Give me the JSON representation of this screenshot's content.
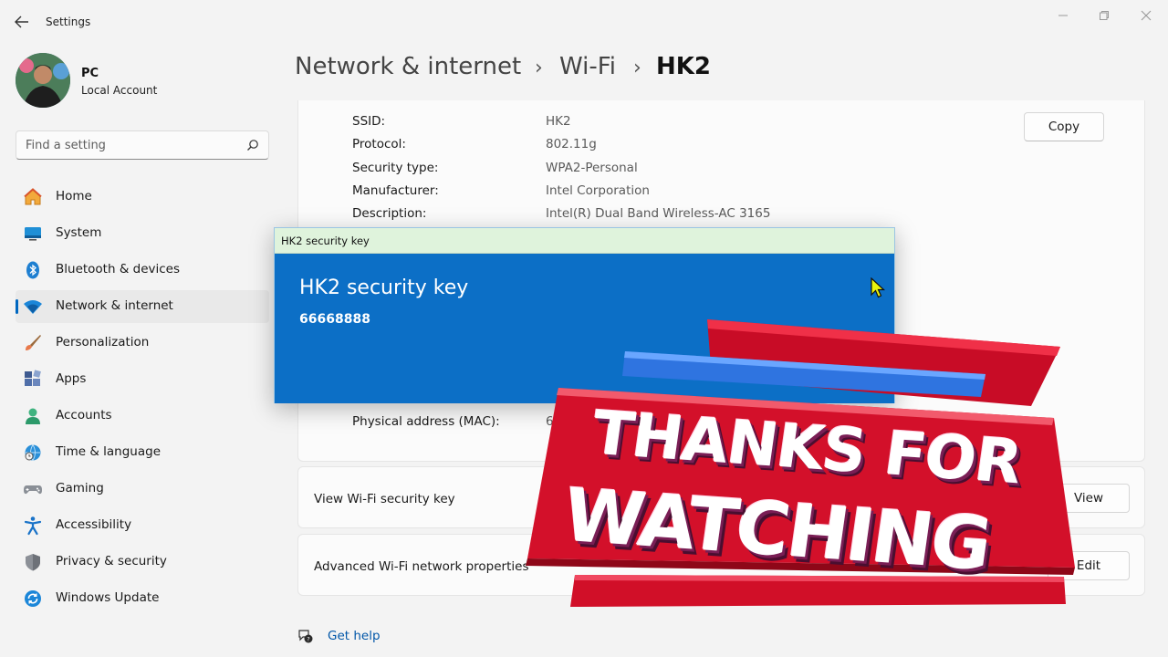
{
  "app": {
    "title": "Settings"
  },
  "user": {
    "name": "PC",
    "account_type": "Local Account"
  },
  "search": {
    "placeholder": "Find a setting"
  },
  "sidebar": {
    "items": [
      {
        "label": "Home",
        "icon": "home-icon"
      },
      {
        "label": "System",
        "icon": "system-icon"
      },
      {
        "label": "Bluetooth & devices",
        "icon": "bluetooth-icon"
      },
      {
        "label": "Network & internet",
        "icon": "wifi-icon",
        "active": true
      },
      {
        "label": "Personalization",
        "icon": "brush-icon"
      },
      {
        "label": "Apps",
        "icon": "apps-icon"
      },
      {
        "label": "Accounts",
        "icon": "person-icon"
      },
      {
        "label": "Time & language",
        "icon": "globe-clock-icon"
      },
      {
        "label": "Gaming",
        "icon": "gamepad-icon"
      },
      {
        "label": "Accessibility",
        "icon": "accessibility-icon"
      },
      {
        "label": "Privacy & security",
        "icon": "shield-icon"
      },
      {
        "label": "Windows Update",
        "icon": "update-icon"
      }
    ]
  },
  "breadcrumb": {
    "level1": "Network & internet",
    "level2": "Wi-Fi",
    "current": "HK2",
    "separator": "›"
  },
  "properties": {
    "copy_label": "Copy",
    "rows": [
      {
        "label": "SSID:",
        "value": "HK2"
      },
      {
        "label": "Protocol:",
        "value": "802.11g"
      },
      {
        "label": "Security type:",
        "value": "WPA2-Personal"
      },
      {
        "label": "Manufacturer:",
        "value": "Intel Corporation"
      },
      {
        "label": "Description:",
        "value": "Intel(R) Dual Band Wireless-AC 3165"
      }
    ],
    "mac_label": "Physical address (MAC):",
    "mac_value_visible": "64"
  },
  "security_key_row": {
    "label": "View Wi-Fi security key",
    "button": "View"
  },
  "advanced_row": {
    "label": "Advanced Wi-Fi network properties",
    "button": "Edit"
  },
  "help": {
    "label": "Get help"
  },
  "dialog": {
    "window_title": "HK2 security key",
    "heading": "HK2 security key",
    "key": "66668888"
  },
  "overlay": {
    "line1": "THANKS FOR",
    "line2": "WATCHING"
  },
  "colors": {
    "accent": "#0067c0",
    "dialog_blue": "#0c6fc6",
    "overlay_red": "#d3102a"
  }
}
